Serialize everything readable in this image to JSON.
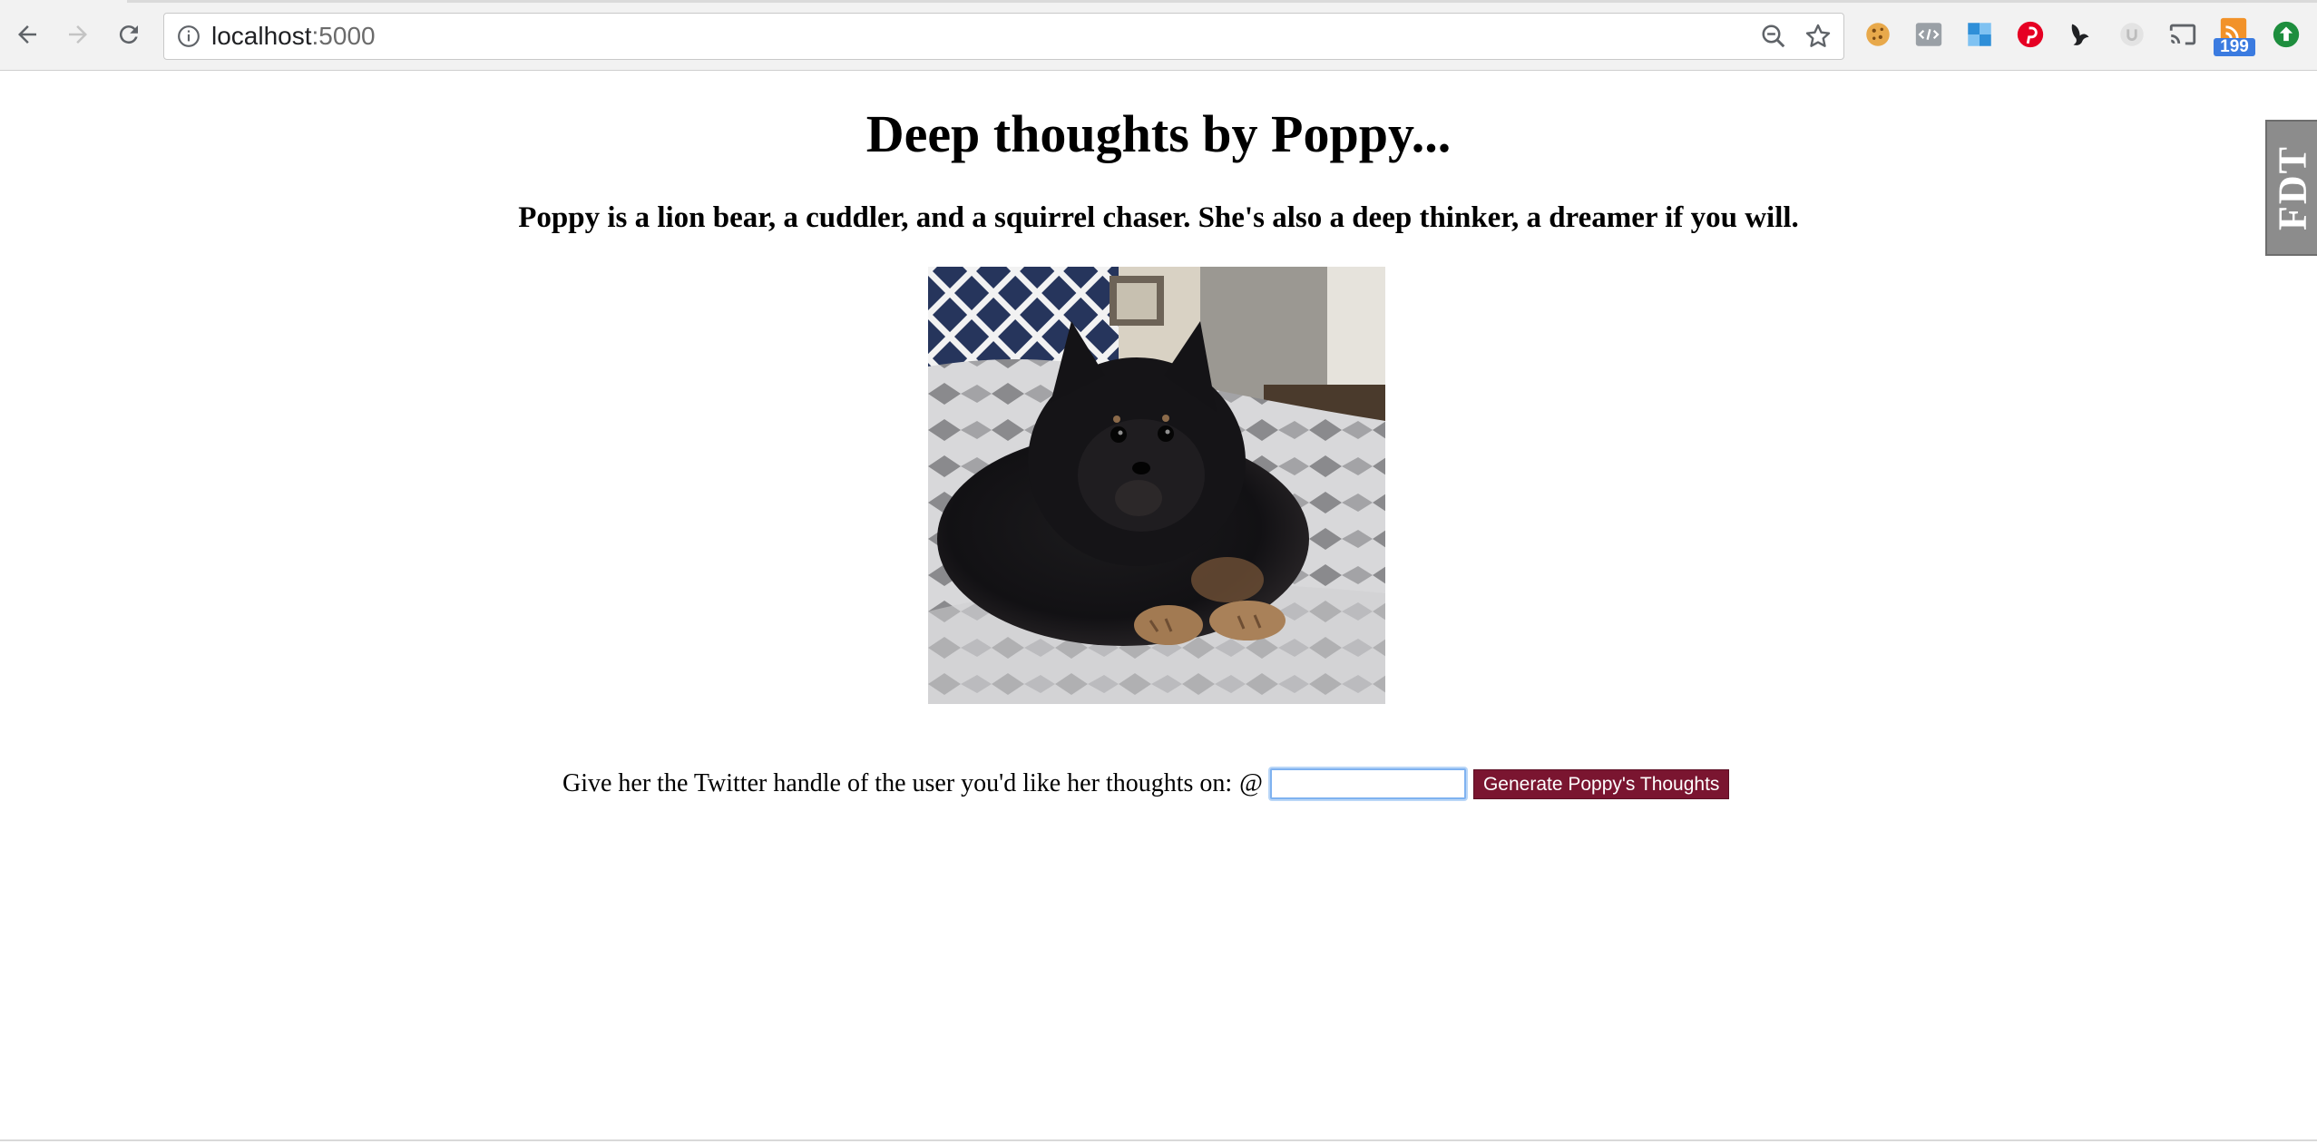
{
  "browser": {
    "url_host": "localhost",
    "url_port": ":5000",
    "extension_badge_count": "199",
    "nav_icons": [
      "back-arrow-icon",
      "forward-arrow-icon",
      "reload-icon"
    ],
    "omnibox_icons": [
      "site-info-icon",
      "zoom-out-icon",
      "bookmark-star-icon"
    ],
    "extension_icons": [
      "cookie-icon",
      "code-icon",
      "puzzle-map-icon",
      "pinterest-icon",
      "bird-icon",
      "circle-u-icon",
      "cast-icon",
      "feed-icon",
      "upload-arrow-icon"
    ]
  },
  "page": {
    "title": "Deep thoughts by Poppy...",
    "subtitle": "Poppy is a lion bear, a cuddler, and a squirrel chaser. She's also a deep thinker, a dreamer if you will.",
    "prompt": "Give her the Twitter handle of the user you'd like her thoughts on:",
    "at_symbol": "@",
    "handle_value": "",
    "button_label": "Generate Poppy's Thoughts",
    "side_tab_label": "FDT"
  },
  "colors": {
    "button_bg": "#7a1530",
    "input_focus": "#7fb2f0",
    "side_tab_bg": "#8c8c8c",
    "badge_bg": "#3b7be0"
  }
}
